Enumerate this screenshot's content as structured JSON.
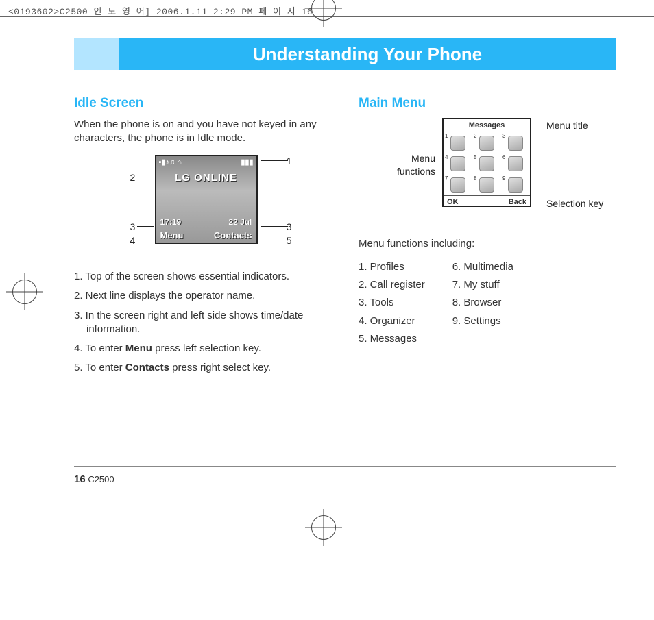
{
  "print_header": "<0193602>C2500 인 도 영 어]  2006.1.11 2:29 PM  페 이 지 16",
  "page_title": "Understanding Your Phone",
  "idle": {
    "heading": "Idle Screen",
    "intro": "When the phone is on and you have not keyed in any characters, the phone is in Idle mode.",
    "screen": {
      "status_left": "▪▮♪♫ ⌂",
      "status_right": "▮▮▮",
      "brand": "LG ONLINE",
      "time": "17:19",
      "date": "22 Jul",
      "soft_left": "Menu",
      "soft_right": "Contacts"
    },
    "callouts": {
      "c1": "1",
      "c2": "2",
      "c3l": "3",
      "c3r": "3",
      "c4": "4",
      "c5": "5"
    },
    "list": {
      "i1": "1. Top of the screen shows essential indicators.",
      "i2": "2. Next line displays the operator name.",
      "i3": "3. In the screen right and left side shows time/date information.",
      "i4a": "4. To enter ",
      "i4b": "Menu",
      "i4c": " press left selection key.",
      "i5a": "5. To enter ",
      "i5b": "Contacts",
      "i5c": " press right select key."
    }
  },
  "main": {
    "heading": "Main Menu",
    "labels": {
      "menu_title": "Menu title",
      "menu_functions": "Menu\nfunctions",
      "selection_key": "Selection key"
    },
    "screen": {
      "title": "Messages",
      "soft_left": "OK",
      "soft_right": "Back",
      "nums": [
        "1",
        "2",
        "3",
        "4",
        "5",
        "6",
        "7",
        "8",
        "9"
      ]
    },
    "including_label": "Menu functions including:",
    "left_list": {
      "i1": "1. Profiles",
      "i2": "2. Call register",
      "i3": "3. Tools",
      "i4": "4. Organizer",
      "i5": "5. Messages"
    },
    "right_list": {
      "i6": "6. Multimedia",
      "i7": "7. My stuff",
      "i8": "8. Browser",
      "i9": "9. Settings"
    }
  },
  "footer": {
    "page_num": "16",
    "model": "C2500"
  }
}
